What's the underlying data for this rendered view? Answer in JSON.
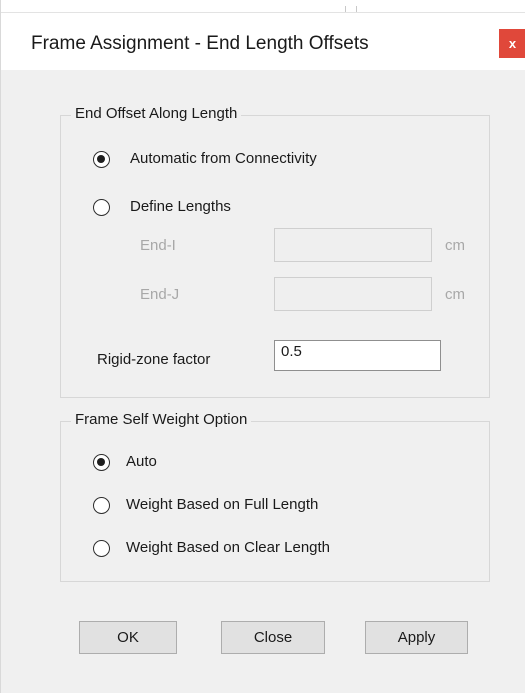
{
  "window": {
    "title": "Frame Assignment - End Length Offsets",
    "close_label": "x"
  },
  "end_offset_group": {
    "legend": "End Offset Along Length",
    "options": [
      {
        "label": "Automatic from Connectivity",
        "selected": true
      },
      {
        "label": "Define Lengths",
        "selected": false
      }
    ],
    "end_i": {
      "label": "End-I",
      "value": "",
      "unit": "cm",
      "enabled": false
    },
    "end_j": {
      "label": "End-J",
      "value": "",
      "unit": "cm",
      "enabled": false
    },
    "rigid_zone": {
      "label": "Rigid-zone factor",
      "value": "0.5"
    }
  },
  "self_weight_group": {
    "legend": "Frame Self Weight Option",
    "options": [
      {
        "label": "Auto",
        "selected": true
      },
      {
        "label": "Weight Based on Full Length",
        "selected": false
      },
      {
        "label": "Weight Based on Clear Length",
        "selected": false
      }
    ]
  },
  "buttons": {
    "ok": "OK",
    "close": "Close",
    "apply": "Apply"
  }
}
